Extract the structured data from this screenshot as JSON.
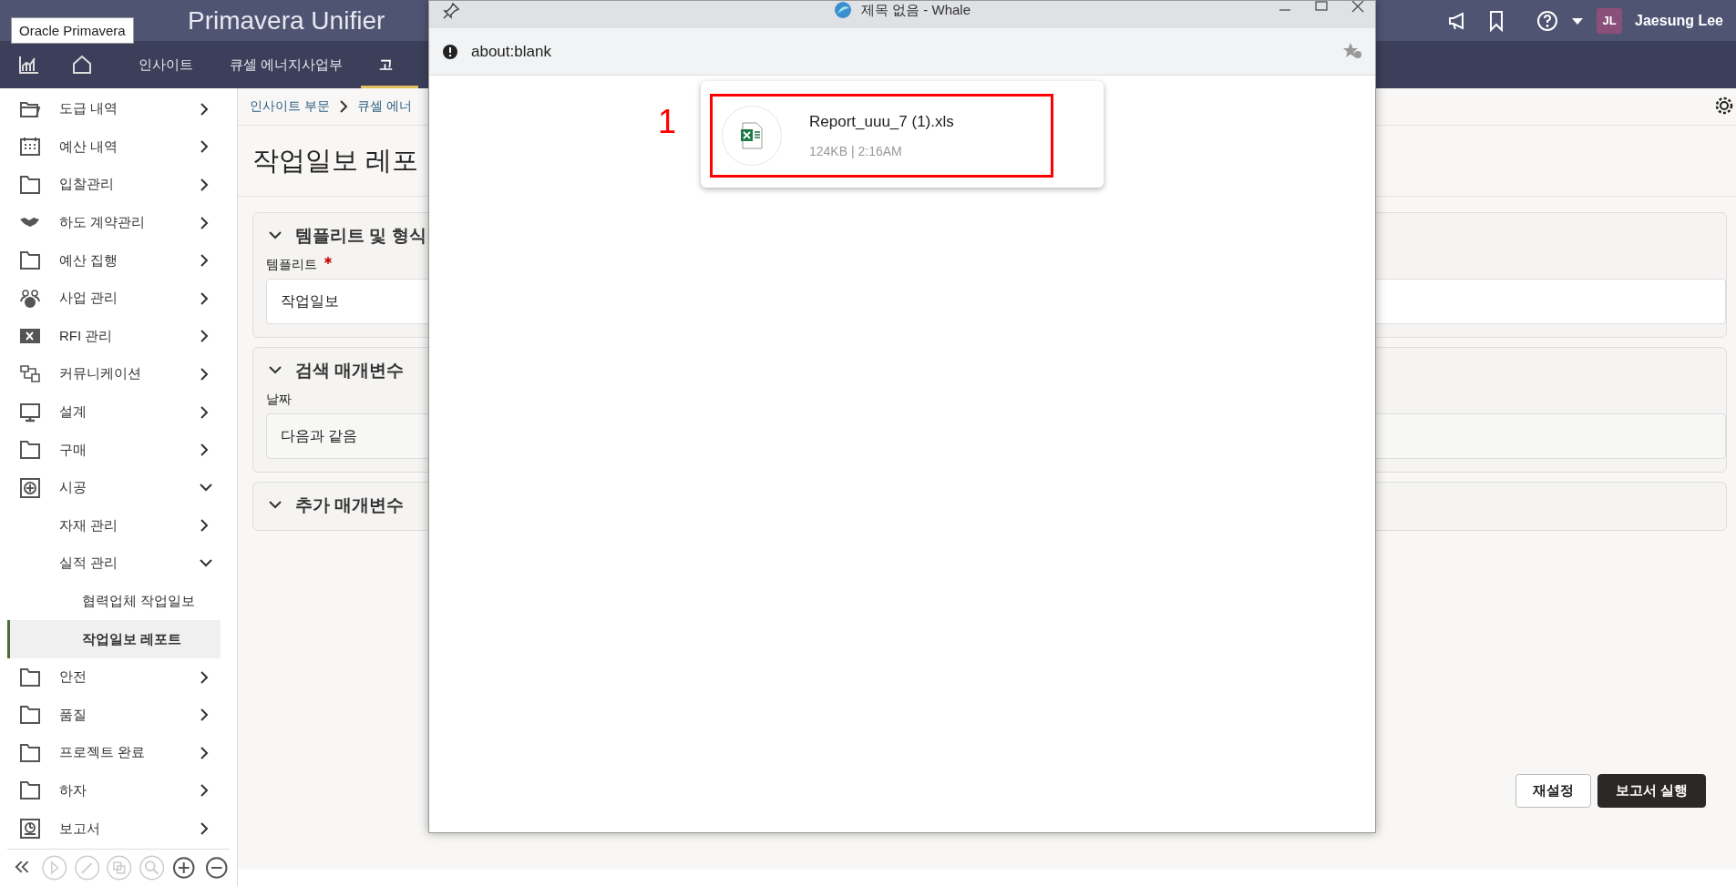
{
  "header": {
    "logo": "Primavera Unifier",
    "tooltip": "Oracle Primavera",
    "user_initials": "JL",
    "user_name": "Jaesung Lee"
  },
  "nav_tabs": [
    {
      "label": "인사이트",
      "selected": false
    },
    {
      "label": "큐셀 에너지사업부",
      "selected": false
    },
    {
      "label": "고",
      "selected": true
    }
  ],
  "sidebar": {
    "items": [
      {
        "label": "도급 내역",
        "expanded": false,
        "selected": false
      },
      {
        "label": "예산 내역",
        "expanded": false,
        "selected": false
      },
      {
        "label": "입찰관리",
        "expanded": false,
        "selected": false
      },
      {
        "label": "하도 계약관리",
        "expanded": false,
        "selected": false
      },
      {
        "label": "예산 집행",
        "expanded": false,
        "selected": false
      },
      {
        "label": "사업 관리",
        "expanded": false,
        "selected": false
      },
      {
        "label": "RFI 관리",
        "expanded": false,
        "selected": false
      },
      {
        "label": "커뮤니케이션",
        "expanded": false,
        "selected": false
      },
      {
        "label": "설계",
        "expanded": false,
        "selected": false
      },
      {
        "label": "구매",
        "expanded": false,
        "selected": false
      },
      {
        "label": "시공",
        "expanded": true,
        "selected": false,
        "children": [
          {
            "label": "자재 관리",
            "expanded": false,
            "selected": false
          },
          {
            "label": "실적 관리",
            "expanded": true,
            "selected": false,
            "children": [
              {
                "label": "협력업체 작업일보",
                "selected": false
              },
              {
                "label": "작업일보 레포트",
                "selected": true
              }
            ]
          }
        ]
      },
      {
        "label": "안전",
        "expanded": false,
        "selected": false
      },
      {
        "label": "품질",
        "expanded": false,
        "selected": false
      },
      {
        "label": "프로젝트 완료",
        "expanded": false,
        "selected": false
      },
      {
        "label": "하자",
        "expanded": false,
        "selected": false
      },
      {
        "label": "보고서",
        "expanded": false,
        "selected": false
      }
    ]
  },
  "breadcrumb": [
    "인사이트 부문",
    "큐셀 에너"
  ],
  "page_title": "작업일보 레포",
  "sections": [
    {
      "title": "템플리트 및 형식",
      "expanded": true,
      "field_label": "템플리트",
      "required": true,
      "value": "작업일보"
    },
    {
      "title": "검색 매개변수",
      "expanded": true,
      "field_label": "날짜",
      "required": false,
      "value": "다음과 같음"
    },
    {
      "title": "추가 매개변수",
      "expanded": true
    }
  ],
  "buttons": [
    {
      "label": "재설정",
      "kind": "secondary"
    },
    {
      "label": "보고서 실행",
      "kind": "primary"
    }
  ],
  "popup": {
    "title": "제목 없음 - Whale",
    "address": "about:blank",
    "download": {
      "file_name": "Report_uuu_7 (1).xls",
      "details": "124KB | 2:16AM"
    },
    "annotation": "1"
  }
}
